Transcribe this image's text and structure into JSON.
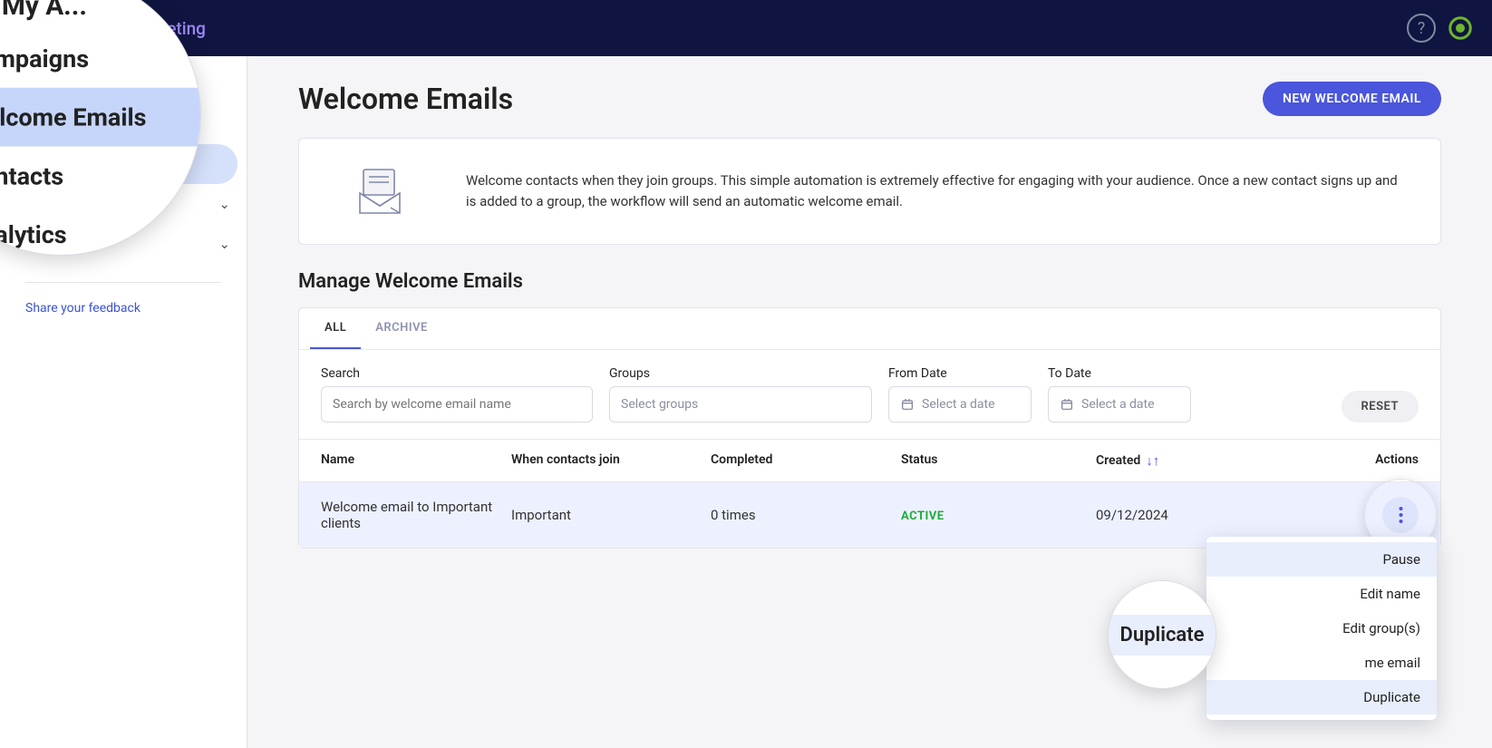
{
  "header": {
    "brand": "",
    "section": "Email Marketing"
  },
  "sidebar": {
    "goto": "Go To My A...",
    "items": [
      {
        "label": "Campaigns"
      },
      {
        "label": "Welcome Emails"
      },
      {
        "label": "Contacts"
      },
      {
        "label": "Analytics"
      }
    ],
    "feedback": "Share your feedback"
  },
  "page": {
    "title": "Welcome Emails",
    "new_button": "NEW WELCOME EMAIL",
    "info_text": "Welcome contacts when they join groups. This simple automation is extremely effective for engaging with your audience. Once a new contact signs up and is added to a group, the workflow will send an automatic welcome email.",
    "manage_title": "Manage Welcome Emails"
  },
  "tabs": {
    "all": "ALL",
    "archive": "ARCHIVE"
  },
  "filters": {
    "search_label": "Search",
    "search_placeholder": "Search by welcome email name",
    "groups_label": "Groups",
    "groups_placeholder": "Select groups",
    "from_label": "From Date",
    "to_label": "To Date",
    "date_placeholder": "Select a date",
    "reset": "RESET"
  },
  "table": {
    "headers": {
      "name": "Name",
      "join": "When contacts join",
      "completed": "Completed",
      "status": "Status",
      "created": "Created",
      "actions": "Actions"
    },
    "row": {
      "name": "Welcome email to Important clients",
      "join": "Important",
      "completed": "0 times",
      "status": "ACTIVE",
      "created": "09/12/2024"
    }
  },
  "dropdown": {
    "pause": "Pause",
    "edit_name": "Edit name",
    "edit_groups": "Edit group(s)",
    "edit_welcome": "Edit welcome email",
    "duplicate": "Duplicate",
    "partial_welcome": "me email"
  },
  "magnifier": {
    "goto": "Go To My A...",
    "campaigns": "Campaigns",
    "welcome": "Welcome Emails",
    "contacts": "Contacts",
    "analytics": "Analytics",
    "duplicate": "Duplicate"
  },
  "colors": {
    "primary": "#4a56db",
    "active_bg": "#d5e0fb",
    "status_green": "#1cad3c"
  }
}
